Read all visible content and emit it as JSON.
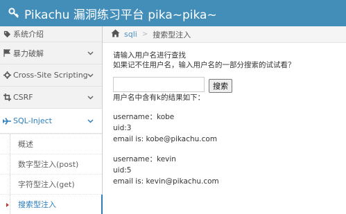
{
  "header": {
    "title": "Pikachu 漏洞练习平台 pika~pika~"
  },
  "sidebar": {
    "items": [
      {
        "label": "系统介绍"
      },
      {
        "label": "暴力破解"
      },
      {
        "label": "Cross-Site Scripting"
      },
      {
        "label": "CSRF"
      },
      {
        "label": "SQL-Inject"
      }
    ],
    "sub_items": [
      {
        "label": "概述"
      },
      {
        "label": "数字型注入(post)"
      },
      {
        "label": "字符型注入(get)"
      },
      {
        "label": "搜索型注入"
      }
    ]
  },
  "breadcrumb": {
    "parent": "sqli",
    "current": "搜索型注入"
  },
  "main": {
    "prompt1": "请输入用户名进行查找",
    "prompt2": "如果记不住用户名，输入用户名的一部分搜索的试试看？",
    "search_value": "",
    "search_button": "搜索",
    "result_header": "用户名中含有k的结果如下：",
    "results": [
      {
        "username": "username：kobe",
        "uid": "uid:3",
        "email": "email is: kobe@pikachu.com"
      },
      {
        "username": "username：kevin",
        "uid": "uid:5",
        "email": "email is: kevin@pikachu.com"
      }
    ]
  },
  "colors": {
    "topbar": "#438eb9",
    "link": "#2b7dbc",
    "active_marker": "#cc3333"
  },
  "icons": [
    "key-icon",
    "tag-icon",
    "flag-icon",
    "settings-icon",
    "crop-icon",
    "airplane-icon",
    "chevron-down-icon",
    "home-icon",
    "caret-right-icon"
  ]
}
